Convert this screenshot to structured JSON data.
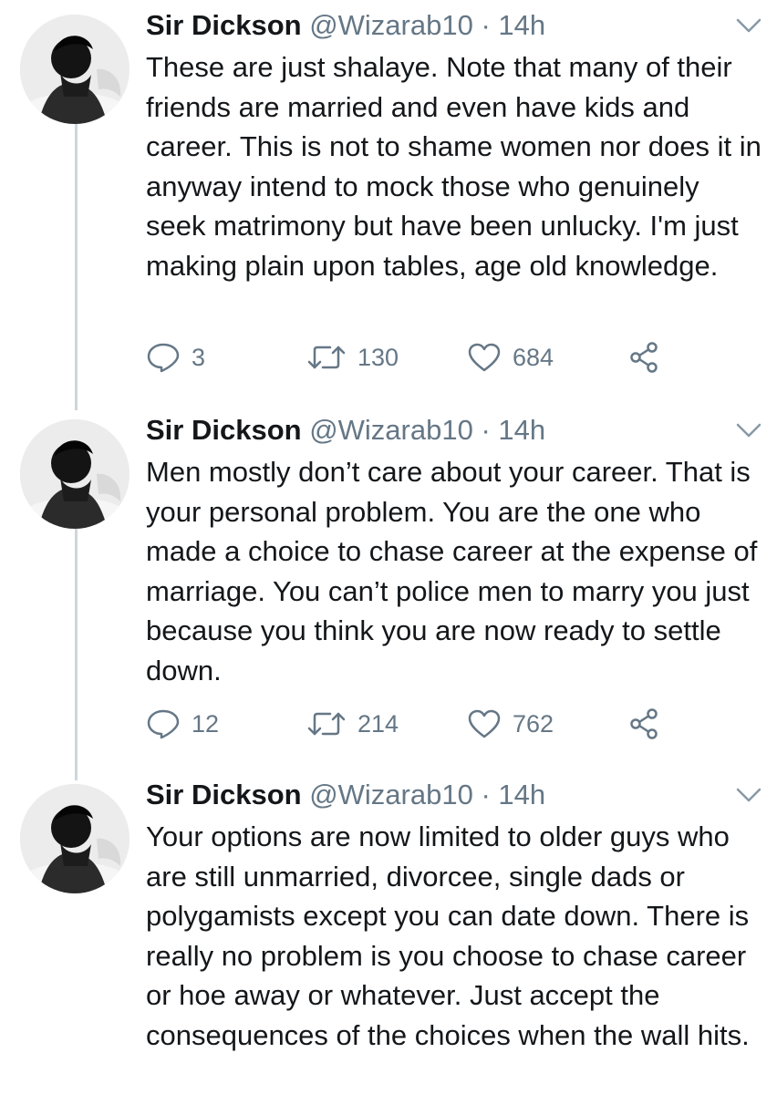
{
  "tweets": [
    {
      "name": "Sir Dickson",
      "handle": "@Wizarab10",
      "separator": "·",
      "time": "14h",
      "text": "These are just shalaye. Note that many of their friends are married and even have kids and career. This is not to shame women nor does it in anyway intend to mock those who genuinely seek matrimony but have been unlucky. I'm just making plain upon tables, age old knowledge.",
      "replies": "3",
      "retweets": "130",
      "likes": "684"
    },
    {
      "name": "Sir Dickson",
      "handle": "@Wizarab10",
      "separator": "·",
      "time": "14h",
      "text": "Men mostly don’t care about your career. That is your personal problem. You are the one who made a choice to chase career at the expense of marriage. You can’t police men to marry you just because you think you are now ready to settle down.",
      "replies": "12",
      "retweets": "214",
      "likes": "762"
    },
    {
      "name": "Sir Dickson",
      "handle": "@Wizarab10",
      "separator": "·",
      "time": "14h",
      "text": "Your options are now limited to older guys who are still unmarried, divorcee, single dads or polygamists  except you can date down. There is really no problem is you choose to chase career or hoe away or whatever. Just accept the consequences of the choices when the wall hits."
    }
  ],
  "icons": {
    "reply": "reply-icon",
    "retweet": "retweet-icon",
    "like": "heart-icon",
    "share": "share-icon",
    "menu": "chevron-down-icon"
  },
  "colors": {
    "text": "#14171a",
    "secondary": "#657786",
    "thread_line": "#ccd6dd"
  }
}
